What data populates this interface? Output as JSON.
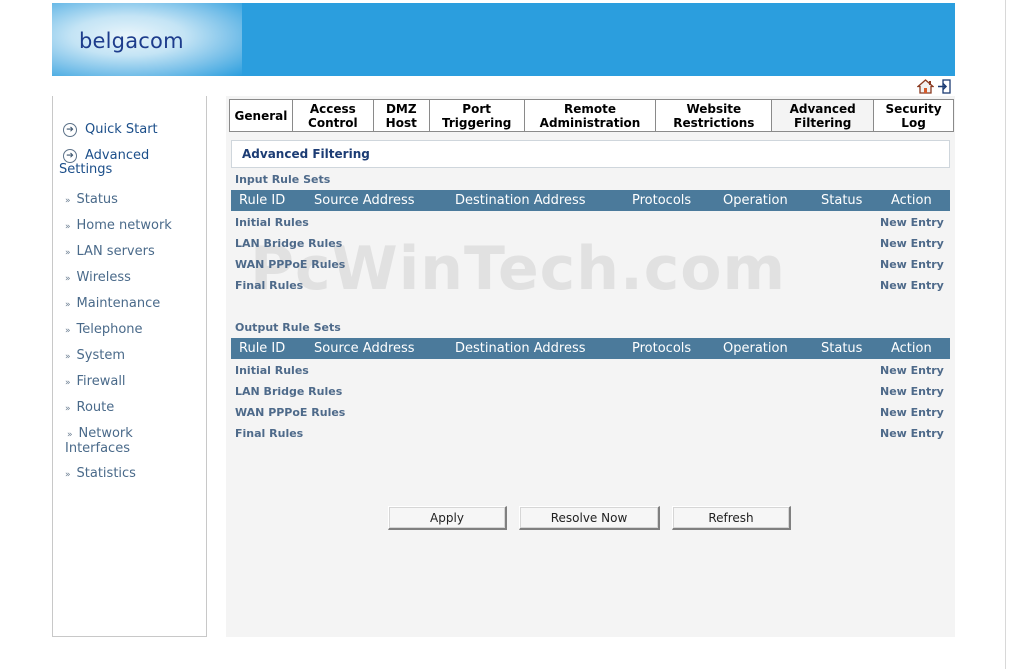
{
  "brand": {
    "logo_text": "belgacom"
  },
  "top_icons": {
    "home": "home-icon",
    "logout": "logout-icon"
  },
  "sidebar": {
    "main": [
      {
        "label": "Quick Start"
      },
      {
        "label": "Advanced Settings"
      }
    ],
    "items": [
      {
        "label": "Status"
      },
      {
        "label": "Home network"
      },
      {
        "label": "LAN servers"
      },
      {
        "label": "Wireless"
      },
      {
        "label": "Maintenance"
      },
      {
        "label": "Telephone"
      },
      {
        "label": "System"
      },
      {
        "label": "Firewall"
      },
      {
        "label": "Route"
      },
      {
        "label": "Network Interfaces"
      },
      {
        "label": "Statistics"
      }
    ]
  },
  "tabs": [
    {
      "line1": "General",
      "line2": ""
    },
    {
      "line1": "Access",
      "line2": "Control"
    },
    {
      "line1": "DMZ",
      "line2": "Host"
    },
    {
      "line1": "Port",
      "line2": "Triggering"
    },
    {
      "line1": "Remote",
      "line2": "Administration"
    },
    {
      "line1": "Website",
      "line2": "Restrictions"
    },
    {
      "line1": "Advanced",
      "line2": "Filtering"
    },
    {
      "line1": "Security",
      "line2": "Log"
    }
  ],
  "section": {
    "title": "Advanced Filtering"
  },
  "input_rules": {
    "title": "Input Rule Sets",
    "columns": [
      "Rule ID",
      "Source Address",
      "Destination Address",
      "Protocols",
      "Operation",
      "Status",
      "Action"
    ],
    "rows": [
      {
        "name": "Initial Rules",
        "action": "New Entry"
      },
      {
        "name": "LAN Bridge Rules",
        "action": "New Entry"
      },
      {
        "name": "WAN PPPoE Rules",
        "action": "New Entry"
      },
      {
        "name": "Final Rules",
        "action": "New Entry"
      }
    ]
  },
  "output_rules": {
    "title": "Output Rule Sets",
    "columns": [
      "Rule ID",
      "Source Address",
      "Destination Address",
      "Protocols",
      "Operation",
      "Status",
      "Action"
    ],
    "rows": [
      {
        "name": "Initial Rules",
        "action": "New Entry"
      },
      {
        "name": "LAN Bridge Rules",
        "action": "New Entry"
      },
      {
        "name": "WAN PPPoE Rules",
        "action": "New Entry"
      },
      {
        "name": "Final Rules",
        "action": "New Entry"
      }
    ]
  },
  "buttons": {
    "apply": "Apply",
    "resolve": "Resolve Now",
    "refresh": "Refresh"
  },
  "watermark": "PcWinTech.com"
}
